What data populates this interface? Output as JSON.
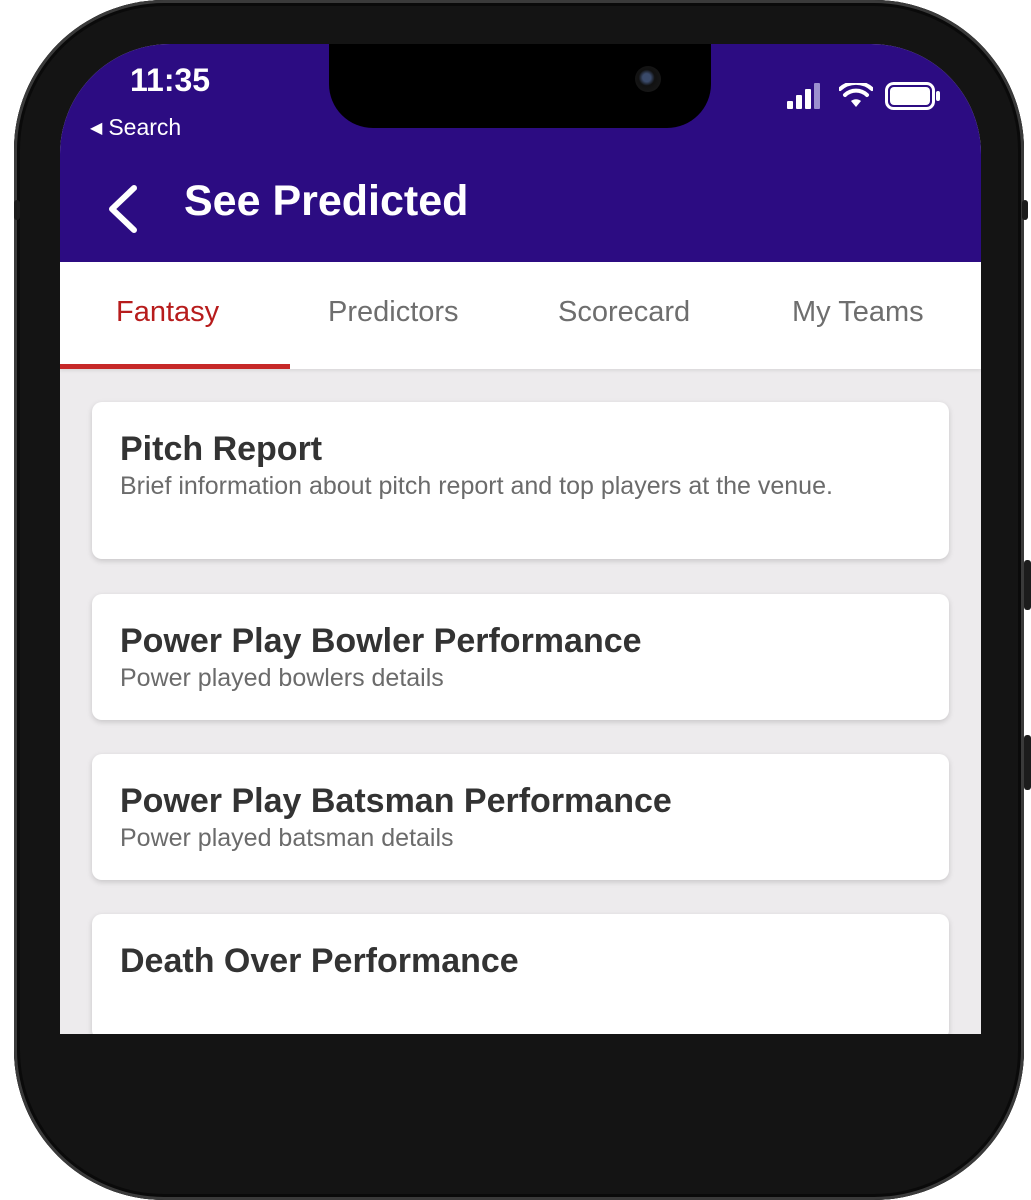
{
  "status_bar": {
    "time": "11:35",
    "back_app": "Search",
    "back_app_icon": "back-triangle-icon"
  },
  "nav": {
    "back_icon": "chevron-left-icon",
    "title": "See Predicted",
    "background": "#2c0c82"
  },
  "tabs": [
    {
      "label": "Fantasy",
      "active": true
    },
    {
      "label": "Predictors",
      "active": false
    },
    {
      "label": "Scorecard",
      "active": false
    },
    {
      "label": "My Teams",
      "active": false
    }
  ],
  "accent_color": "#c62828",
  "cards": [
    {
      "title": "Pitch Report",
      "description": "Brief information about pitch report and top players at the venue."
    },
    {
      "title": "Power Play Bowler Performance",
      "description": "Power played bowlers details"
    },
    {
      "title": "Power Play Batsman Performance",
      "description": "Power played batsman details"
    },
    {
      "title": "Death Over Performance",
      "description": ""
    }
  ]
}
